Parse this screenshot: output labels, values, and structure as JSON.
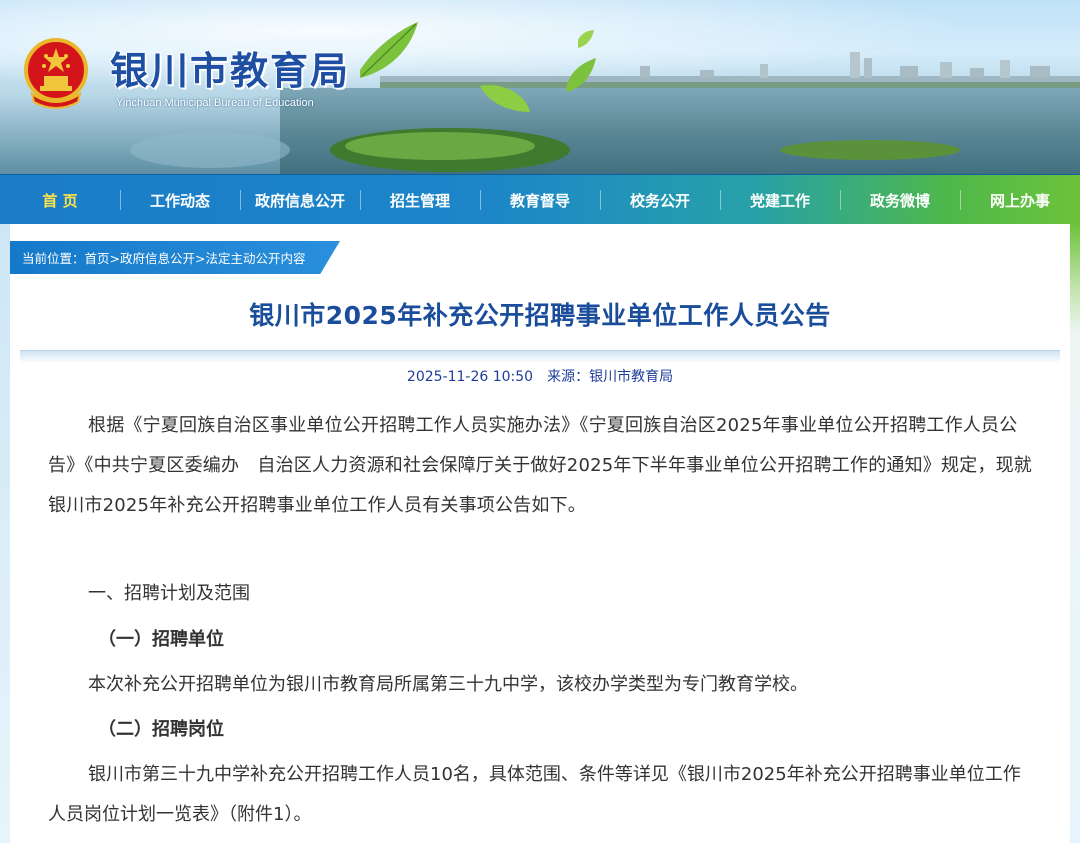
{
  "header": {
    "title": "银川市教育局",
    "subtitle": "Yinchuan Municipal Bureau of Education"
  },
  "nav": {
    "items": [
      "首 页",
      "工作动态",
      "政府信息公开",
      "招生管理",
      "教育督导",
      "校务公开",
      "党建工作",
      "政务微博",
      "网上办事"
    ],
    "active_index": 0
  },
  "breadcrumb": {
    "prefix": "当前位置：",
    "links": [
      "首页",
      ">政府信息公开",
      ">法定主动公开内容"
    ]
  },
  "article": {
    "title": "银川市2025年补充公开招聘事业单位工作人员公告",
    "date": "2025-11-26 10:50",
    "source": "来源：银川市教育局",
    "intro": "根据《宁夏回族自治区事业单位公开招聘工作人员实施办法》《宁夏回族自治区2025年事业单位公开招聘工作人员公告》《中共宁夏区委编办　自治区人力资源和社会保障厅关于做好2025年下半年事业单位公开招聘工作的通知》规定，现就银川市2025年补充公开招聘事业单位工作人员有关事项公告如下。",
    "section1": "一、招聘计划及范围",
    "sub1": "（一）招聘单位",
    "sub1_text": "本次补充公开招聘单位为银川市教育局所属第三十九中学，该校办学类型为专门教育学校。",
    "sub2": "（二）招聘岗位",
    "sub2_text": "银川市第三十九中学补充公开招聘工作人员10名，具体范围、条件等详见《银川市2025年补充公开招聘事业单位工作人员岗位计划一览表》（附件1）。"
  },
  "colors": {
    "nav_blue": "#1b7cc8",
    "nav_green": "#6cc33a",
    "title_blue": "#1a4d9c",
    "active_nav": "#ffe14a"
  }
}
